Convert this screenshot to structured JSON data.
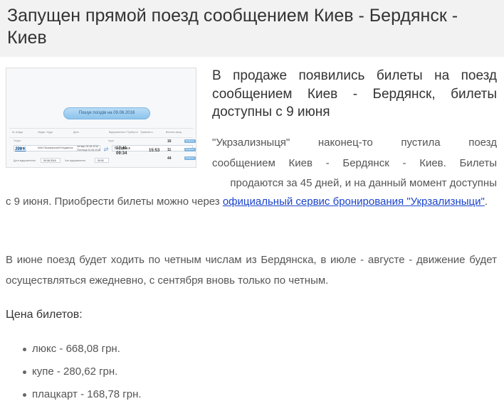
{
  "article": {
    "title": "Запущен прямой поезд сообщением Киев - Бердянск - Киев",
    "lead": "В продаже появились билеты на поезд сообщением Киев - Бердянск, билеты доступны с 9 июня",
    "p1_line1": "\"Укрзализныця\" наконец-то пустила поезд",
    "p1_line2": "сообщением Киев - Бердянск - Киев. Билеты",
    "p1_line3": "продаются за 45 дней, и на данный момент доступны",
    "p1_line4_prefix": "с 9 июня. Приобрести билеты можно через ",
    "p1_link": "официальный сервис бронирования \"Укрзализныци\"",
    "p1_suffix": ".",
    "p2": "В июне поезд будет ходить по четным числам из Бердянска, в июле - августе - движение будет осуществляться ежедневно, с сентября вновь только по четным.",
    "prices_heading": "Цена билетов:",
    "prices": [
      "люкс - 668,08 грн.",
      "купе - 280,62 грн.",
      "плацкарт - 168,78 грн."
    ]
  },
  "booking_thumbnail": {
    "from_label": "Звідки",
    "to_label": "Куди",
    "from_value": "Киев",
    "to_value": "Бердянск",
    "date_label": "Дата відправлення",
    "date_value": "09.06.2016",
    "time_label": "Час відправлення",
    "time_value": "00:00",
    "search_button": "Пошук поїздів на 09.06.2016",
    "columns": [
      "№ поїзда",
      "Звідки / Куди",
      "Дата",
      "Відправлення / Прибуття",
      "Тривалість",
      "Вільних місць"
    ],
    "train": {
      "number": "228 К",
      "route": "Київ-Пасажирський Бердянськ",
      "depart_date": "Четвер 09.06.2016",
      "arrive_date": "П'ятниця 10.06.2016",
      "depart_time": "17:41",
      "arrive_time": "09:34",
      "duration": "15:53",
      "seats": [
        "16",
        "11",
        "44"
      ],
      "choose_label": "Вибрати"
    }
  }
}
